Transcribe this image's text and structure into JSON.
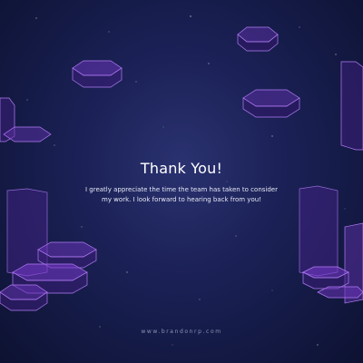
{
  "slide": {
    "title": "Thank You!",
    "message": "I greatly appreciate the time the team has taken to consider my work. I look forward to hearing back from you!",
    "footer_url": "www.brandonrp.com"
  },
  "colors": {
    "background": "#1b2156",
    "prism_glow": "#a66cf0",
    "prism_fill": "#5a2fa0"
  },
  "decoration": {
    "art": "floating translucent purple hexagonal prisms over a starry night sky"
  }
}
